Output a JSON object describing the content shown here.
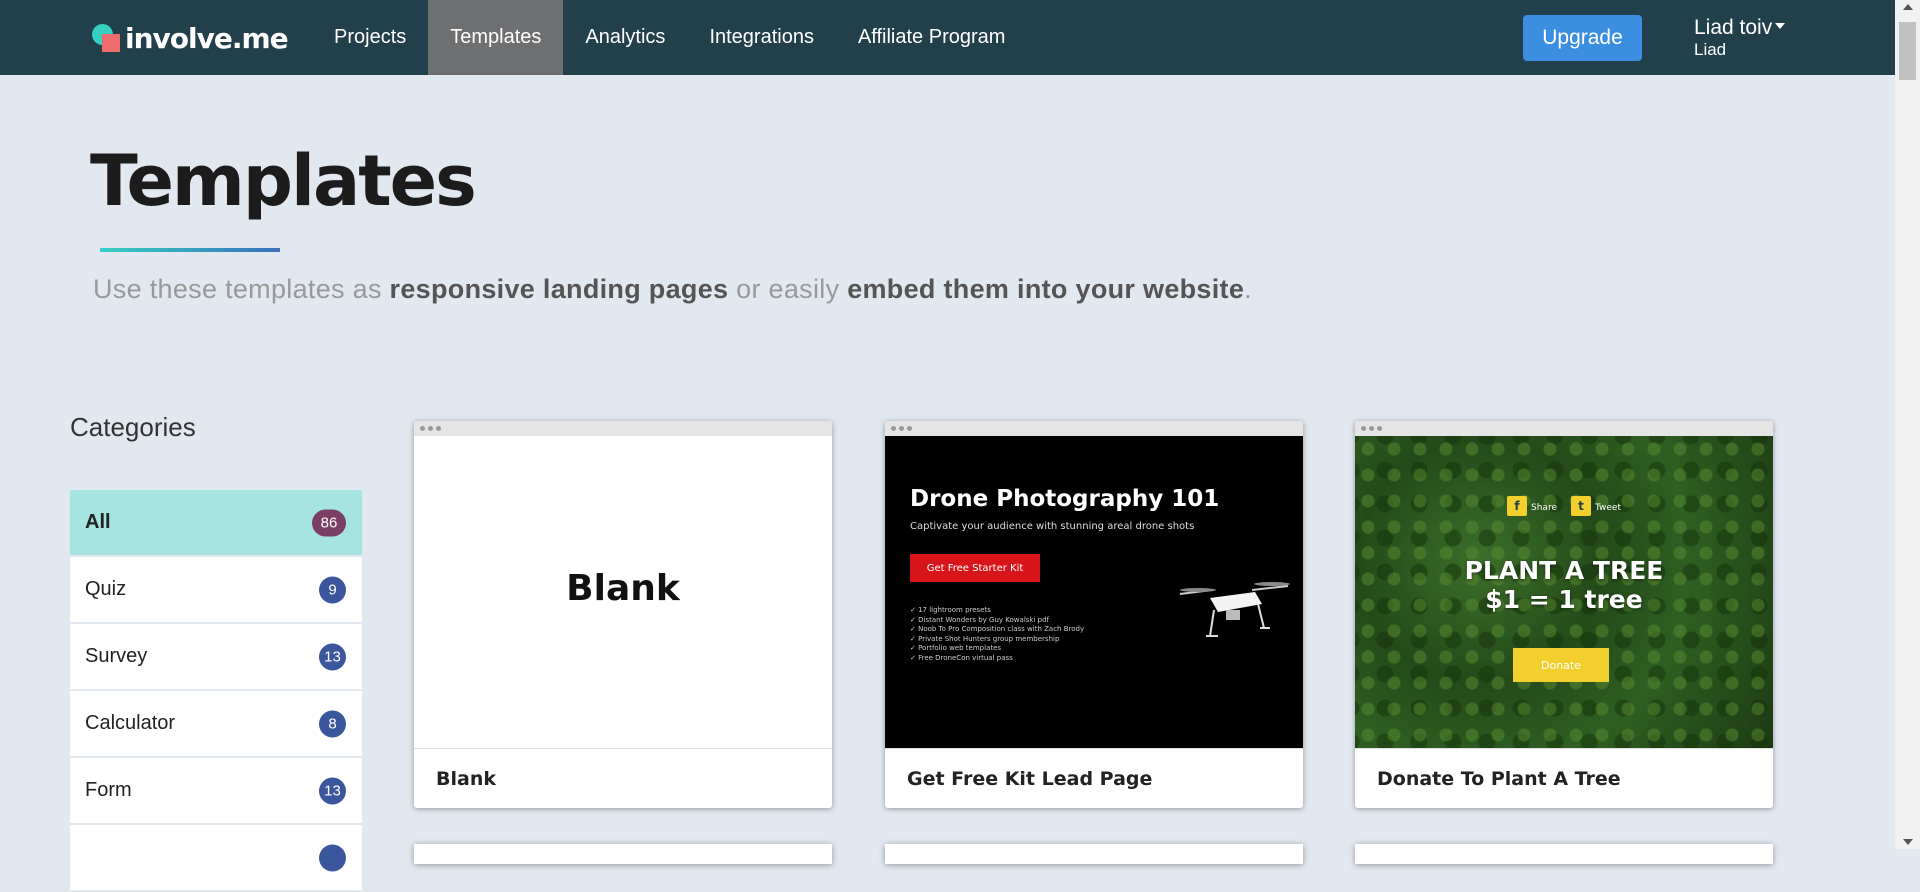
{
  "brand": {
    "logo_text": "involve.me"
  },
  "nav": {
    "links": [
      "Projects",
      "Templates",
      "Analytics",
      "Integrations",
      "Affiliate Program"
    ],
    "active": "Templates",
    "upgrade_label": "Upgrade",
    "user_name": "Liad toiv",
    "user_sub": "Liad"
  },
  "header": {
    "title": "Templates",
    "subtitle_pre": "Use these templates as ",
    "subtitle_b1": "responsive landing pages",
    "subtitle_mid": " or easily ",
    "subtitle_b2": "embed them into your website",
    "subtitle_end": "."
  },
  "categories": {
    "heading": "Categories",
    "items": [
      {
        "label": "All",
        "count": "86"
      },
      {
        "label": "Quiz",
        "count": "9"
      },
      {
        "label": "Survey",
        "count": "13"
      },
      {
        "label": "Calculator",
        "count": "8"
      },
      {
        "label": "Form",
        "count": "13"
      }
    ]
  },
  "cards": [
    {
      "title": "Blank",
      "preview_text": "Blank"
    },
    {
      "title": "Get Free Kit Lead Page",
      "preview_heading": "Drone Photography 101",
      "preview_sub": "Captivate your audience with stunning areal drone shots",
      "preview_button": "Get Free Starter Kit",
      "preview_list": [
        "✓ 17 lightroom presets",
        "✓ Distant Wonders by Guy Kowalski pdf",
        "✓ Noob To Pro Composition class with Zach Brody",
        "✓ Private Shot Hunters group membership",
        "✓ Portfolio web templates",
        "✓ Free DroneCon virtual pass"
      ]
    },
    {
      "title": "Donate To Plant A Tree",
      "preview_share": "Share",
      "preview_tweet": "Tweet",
      "preview_heading_1": "PLANT A TREE",
      "preview_heading_2": "$1 = 1 tree",
      "preview_button": "Donate"
    }
  ],
  "colors": {
    "navbar": "#223f4c",
    "accent": "#3b8ee0",
    "active_category": "#a5e4e0",
    "badge": "#3a569c"
  }
}
